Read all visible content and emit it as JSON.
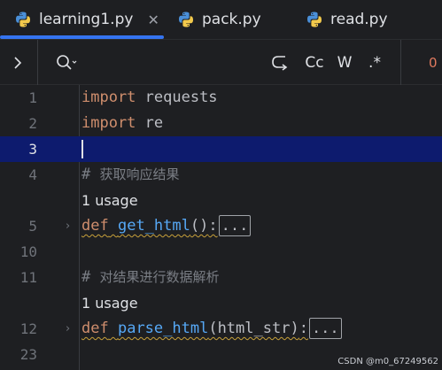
{
  "tabs": [
    {
      "label": "learning1.py",
      "active": true,
      "closable": true,
      "icon": "python-icon"
    },
    {
      "label": "pack.py",
      "active": false,
      "icon": "python-icon"
    },
    {
      "label": "read.py",
      "active": false,
      "icon": "python-icon"
    }
  ],
  "toolbar": {
    "expand_icon": "chevron-right-icon",
    "search_icon": "search-icon",
    "newline_icon": "newline-icon",
    "match_case_label": "Cc",
    "whole_words_label": "W",
    "regex_label": ".*",
    "result_count": "0"
  },
  "editor": {
    "lines": [
      {
        "number": "1",
        "keyword": "import",
        "rest": " requests"
      },
      {
        "number": "2",
        "keyword": "import",
        "rest": " re"
      },
      {
        "number": "3",
        "current": true
      },
      {
        "number": "4",
        "comment_hash": "# ",
        "comment_text": "获取响应结果"
      },
      {
        "usage": "1 usage"
      },
      {
        "number": "5",
        "keyword": "def",
        "fn": "get_html",
        "args": "()",
        "colon": ":",
        "folded": "..."
      },
      {
        "number": "10"
      },
      {
        "number": "11",
        "comment_hash": "# ",
        "comment_text": "对结果进行数据解析"
      },
      {
        "usage": "1 usage"
      },
      {
        "number": "12",
        "keyword": "def",
        "fn": "parse_html",
        "args": "(html_str)",
        "colon": ":",
        "folded": "..."
      },
      {
        "number": "23"
      }
    ]
  },
  "watermark": "CSDN @m0_67249562",
  "colors": {
    "background": "#1e1f22",
    "current_line": "#0d1b6e",
    "keyword": "#cf8e6d",
    "function": "#56a8f5",
    "comment": "#7a7e85",
    "tab_underline": "#3574f0"
  }
}
